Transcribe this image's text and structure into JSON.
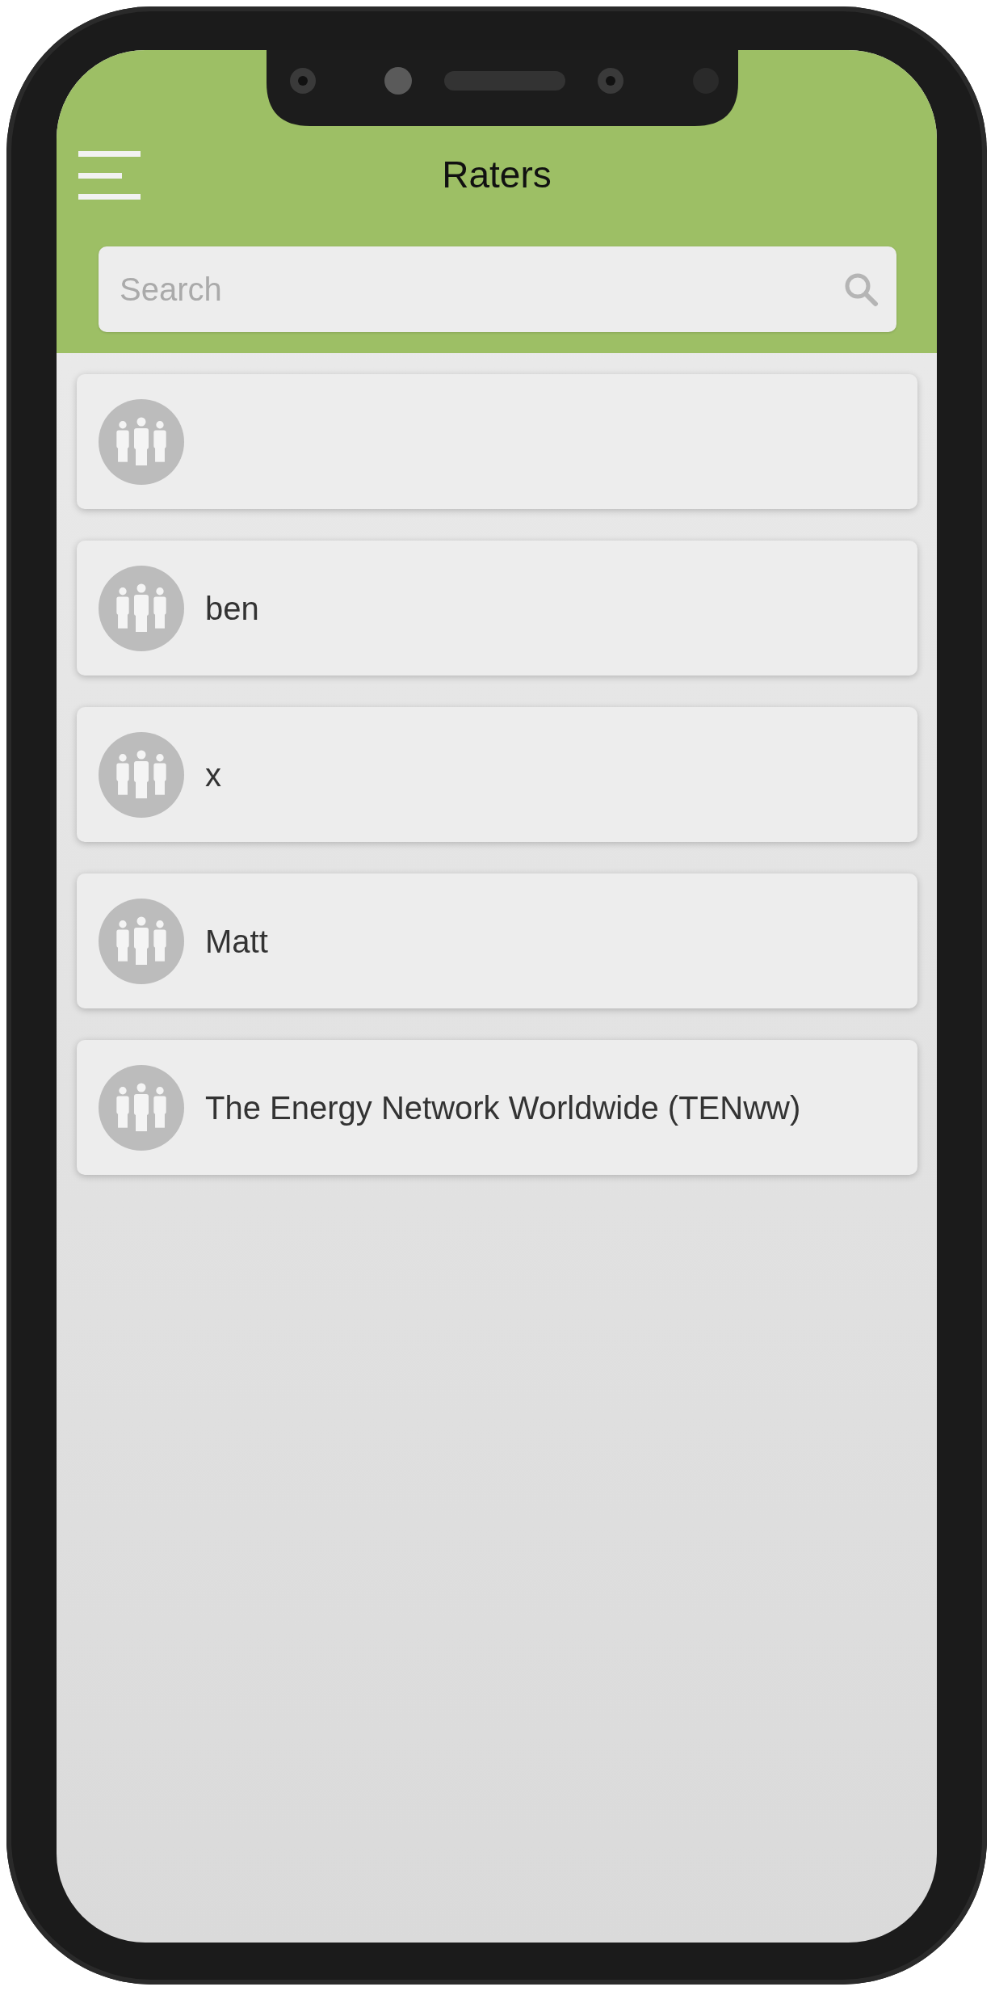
{
  "header": {
    "title": "Raters"
  },
  "search": {
    "placeholder": "Search"
  },
  "raters": [
    {
      "kind": "group"
    },
    {
      "kind": "group",
      "name": "ben"
    },
    {
      "kind": "group",
      "name": "x"
    },
    {
      "kind": "group",
      "name": "Matt"
    },
    {
      "kind": "group",
      "name": "The Energy Network Worldwide (TENww)"
    }
  ]
}
